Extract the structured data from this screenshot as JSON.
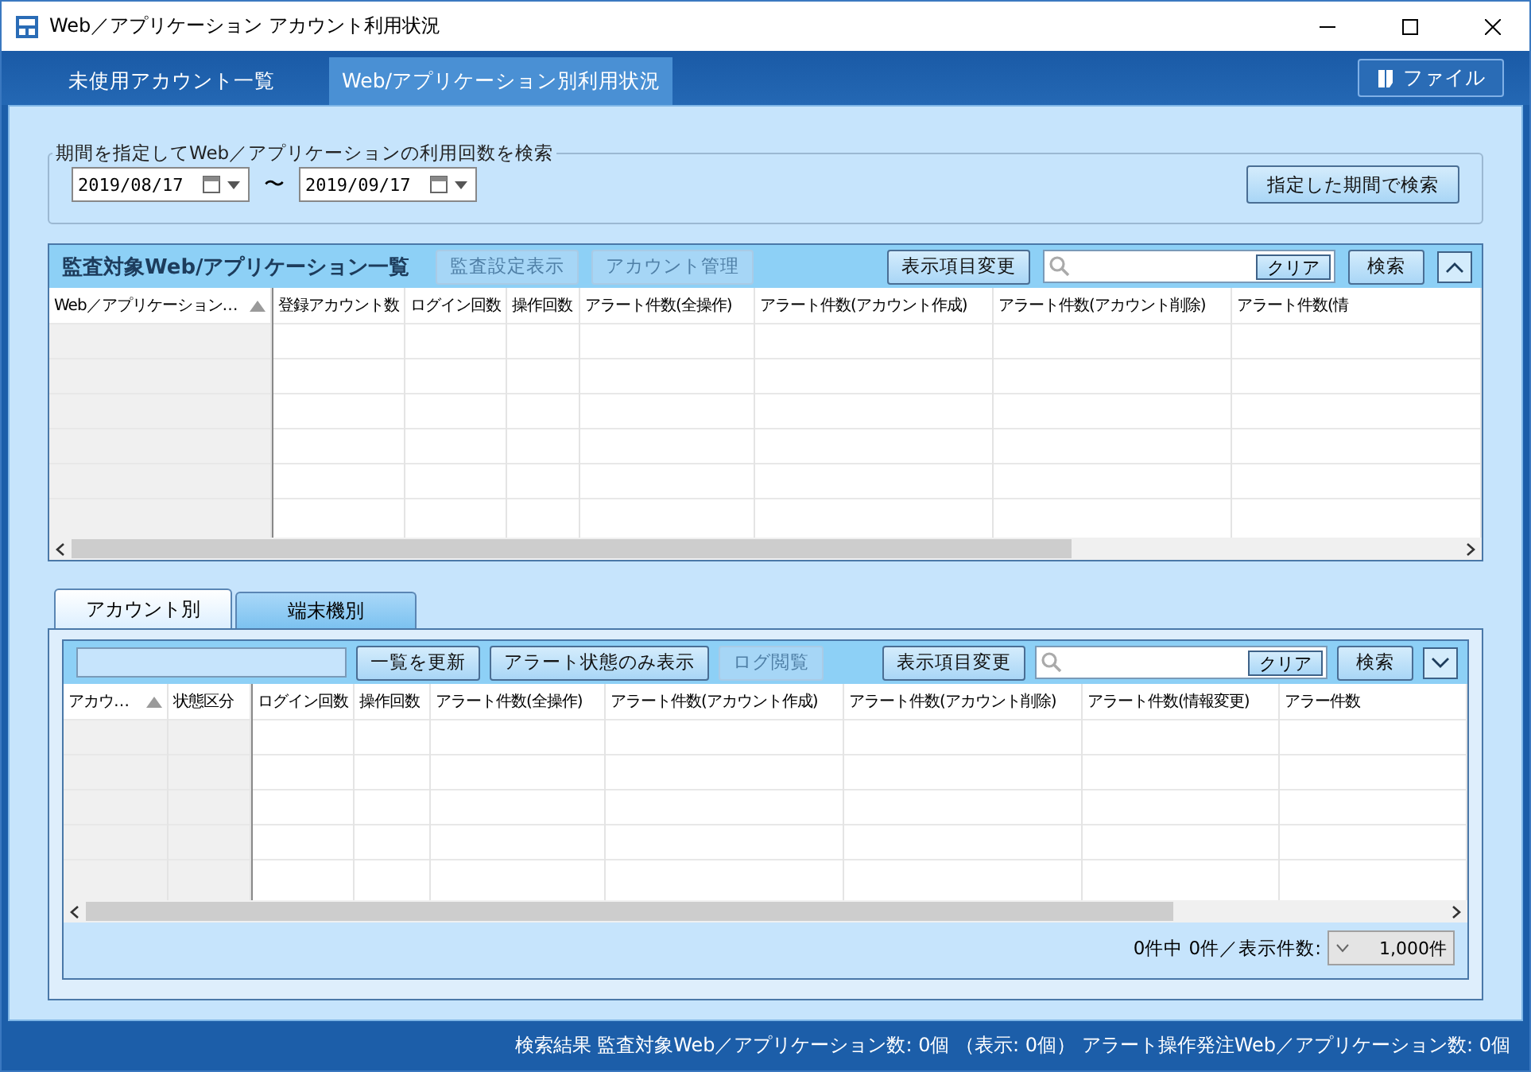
{
  "window": {
    "title": "Web／アプリケーション アカウント利用状況"
  },
  "nav": {
    "tabs": [
      {
        "label": "未使用アカウント一覧",
        "selected": false
      },
      {
        "label": "Web/アプリケーション別利用状況",
        "selected": true
      }
    ],
    "file_button": "ファイル"
  },
  "period_search": {
    "legend": "期間を指定してWeb／アプリケーションの利用回数を検索",
    "from": "2019/08/17",
    "separator": "〜",
    "to": "2019/09/17",
    "button": "指定した期間で検索"
  },
  "app_list": {
    "title": "監査対象Web/アプリケーション一覧",
    "buttons": [
      {
        "label": "監査設定表示",
        "disabled": true
      },
      {
        "label": "アカウント管理",
        "disabled": true
      }
    ],
    "change_columns": "表示項目変更",
    "clear": "クリア",
    "search": "検索",
    "collapsed": false,
    "frozen_columns": [
      {
        "label": "Web／アプリケーション…",
        "sorted": true
      }
    ],
    "columns": [
      "登録アカウント数",
      "ログイン回数",
      "操作回数",
      "アラート件数(全操作)",
      "アラート件数(アカウント作成)",
      "アラート件数(アカウント削除)",
      "アラート件数(情"
    ]
  },
  "detail": {
    "tabs": [
      {
        "label": "アカウント別",
        "selected": true
      },
      {
        "label": "端末機別",
        "selected": false
      }
    ],
    "buttons": [
      {
        "label": "一覧を更新",
        "disabled": false
      },
      {
        "label": "アラート状態のみ表示",
        "disabled": false
      },
      {
        "label": "ログ閲覧",
        "disabled": true
      }
    ],
    "change_columns": "表示項目変更",
    "clear": "クリア",
    "search": "検索",
    "collapsed": true,
    "frozen_columns": [
      {
        "label": "アカウ…",
        "sorted": true
      },
      {
        "label": "状態区分",
        "sorted": false
      }
    ],
    "columns": [
      "ログイン回数",
      "操作回数",
      "アラート件数(全操作)",
      "アラート件数(アカウント作成)",
      "アラート件数(アカウント削除)",
      "アラート件数(情報変更)",
      "アラー件数"
    ],
    "count": "0件中 0件／表示件数:",
    "page_size": "1,000件"
  },
  "status_bar": "検索結果 監査対象Web／アプリケーション数: 0個 （表示: 0個） アラート操作発注Web／アプリケーション数: 0個"
}
